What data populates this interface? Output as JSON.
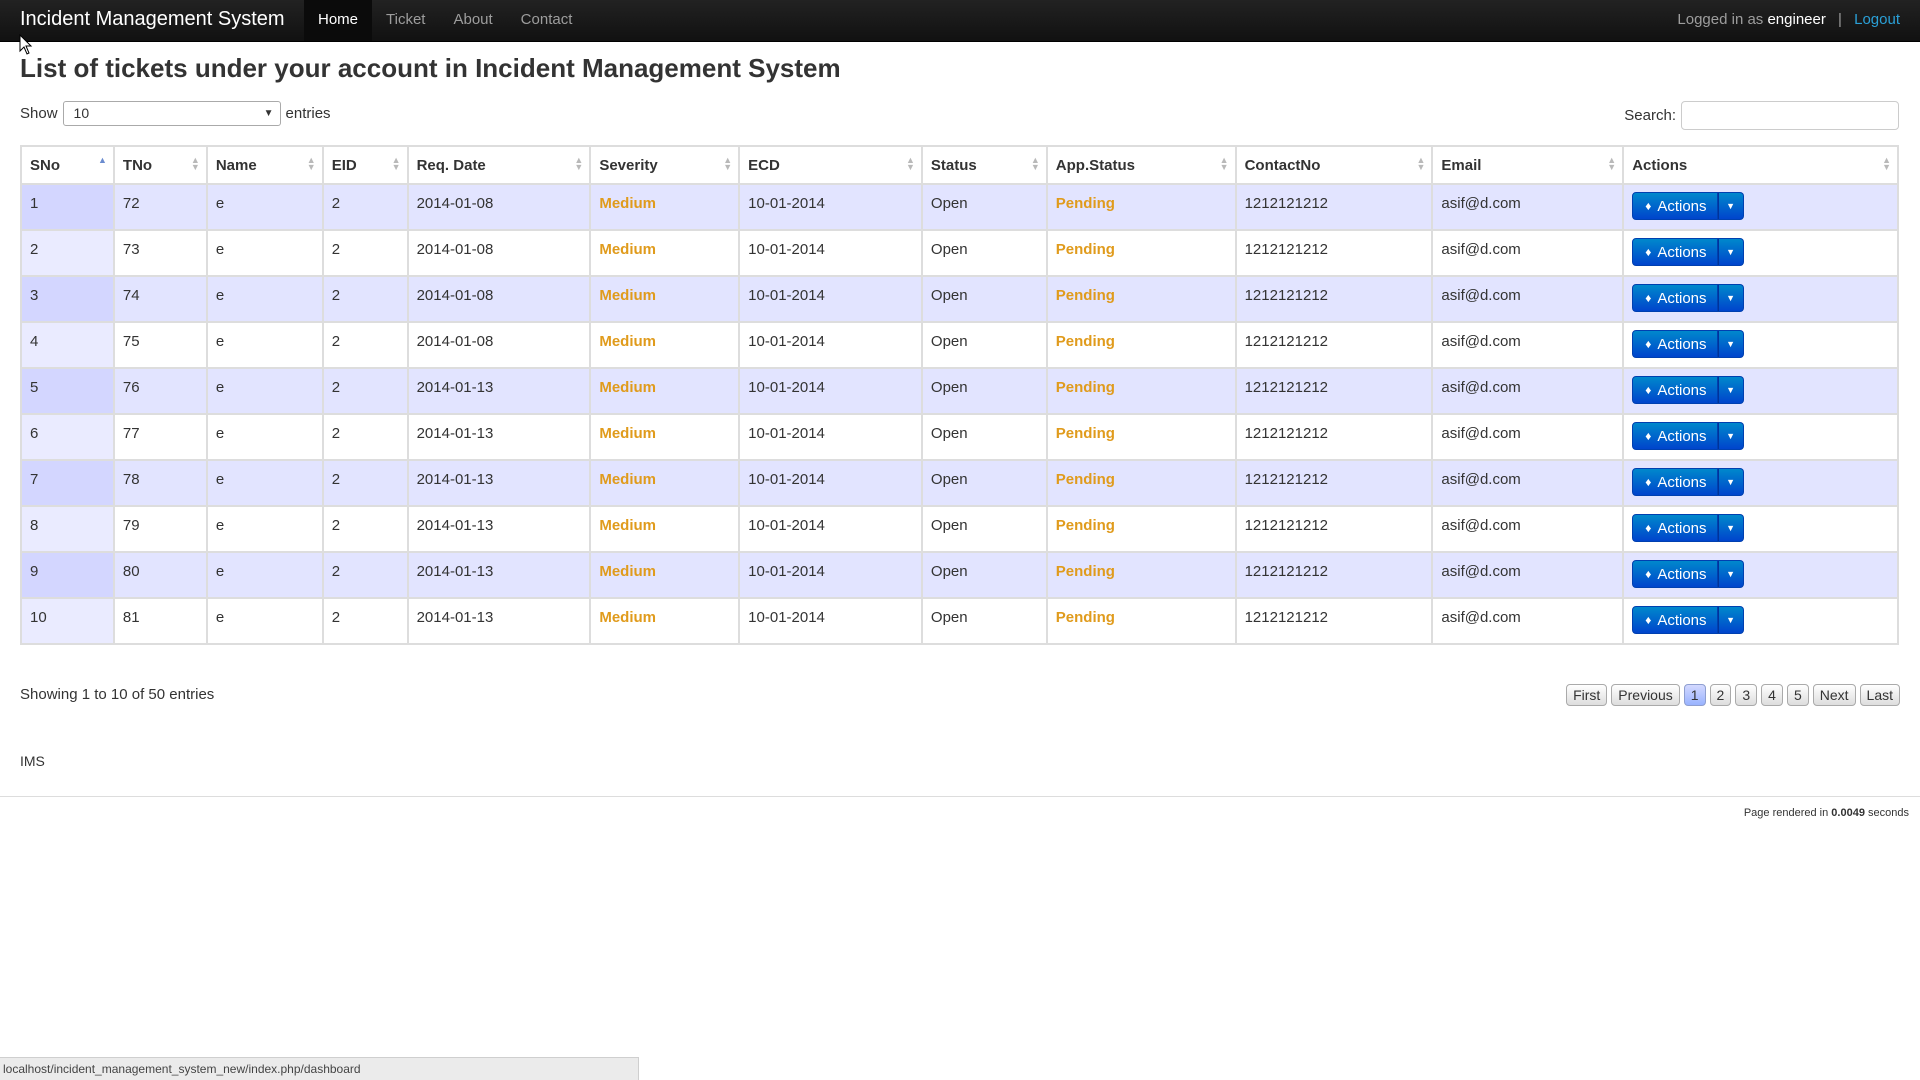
{
  "navbar": {
    "brand": "Incident Management System",
    "items": [
      {
        "label": "Home",
        "active": true
      },
      {
        "label": "Ticket",
        "active": false
      },
      {
        "label": "About",
        "active": false
      },
      {
        "label": "Contact",
        "active": false
      }
    ],
    "logged_in_prefix": "Logged in as",
    "username": "engineer",
    "separator": "|",
    "logout_label": "Logout"
  },
  "page_title": "List of tickets under your account in Incident Management System",
  "length": {
    "show_label": "Show",
    "selected": "10",
    "entries_label": "entries"
  },
  "search": {
    "label": "Search:",
    "value": ""
  },
  "table": {
    "columns": [
      "SNo",
      "TNo",
      "Name",
      "EID",
      "Req. Date",
      "Severity",
      "ECD",
      "Status",
      "App.Status",
      "ContactNo",
      "Email",
      "Actions"
    ],
    "action_label": "Actions",
    "rows": [
      {
        "sno": "1",
        "tno": "72",
        "name": "e",
        "eid": "2",
        "req_date": "2014-01-08",
        "severity": "Medium",
        "ecd": "10-01-2014",
        "status": "Open",
        "app_status": "Pending",
        "contact": "1212121212",
        "email": "asif@d.com"
      },
      {
        "sno": "2",
        "tno": "73",
        "name": "e",
        "eid": "2",
        "req_date": "2014-01-08",
        "severity": "Medium",
        "ecd": "10-01-2014",
        "status": "Open",
        "app_status": "Pending",
        "contact": "1212121212",
        "email": "asif@d.com"
      },
      {
        "sno": "3",
        "tno": "74",
        "name": "e",
        "eid": "2",
        "req_date": "2014-01-08",
        "severity": "Medium",
        "ecd": "10-01-2014",
        "status": "Open",
        "app_status": "Pending",
        "contact": "1212121212",
        "email": "asif@d.com"
      },
      {
        "sno": "4",
        "tno": "75",
        "name": "e",
        "eid": "2",
        "req_date": "2014-01-08",
        "severity": "Medium",
        "ecd": "10-01-2014",
        "status": "Open",
        "app_status": "Pending",
        "contact": "1212121212",
        "email": "asif@d.com"
      },
      {
        "sno": "5",
        "tno": "76",
        "name": "e",
        "eid": "2",
        "req_date": "2014-01-13",
        "severity": "Medium",
        "ecd": "10-01-2014",
        "status": "Open",
        "app_status": "Pending",
        "contact": "1212121212",
        "email": "asif@d.com"
      },
      {
        "sno": "6",
        "tno": "77",
        "name": "e",
        "eid": "2",
        "req_date": "2014-01-13",
        "severity": "Medium",
        "ecd": "10-01-2014",
        "status": "Open",
        "app_status": "Pending",
        "contact": "1212121212",
        "email": "asif@d.com"
      },
      {
        "sno": "7",
        "tno": "78",
        "name": "e",
        "eid": "2",
        "req_date": "2014-01-13",
        "severity": "Medium",
        "ecd": "10-01-2014",
        "status": "Open",
        "app_status": "Pending",
        "contact": "1212121212",
        "email": "asif@d.com"
      },
      {
        "sno": "8",
        "tno": "79",
        "name": "e",
        "eid": "2",
        "req_date": "2014-01-13",
        "severity": "Medium",
        "ecd": "10-01-2014",
        "status": "Open",
        "app_status": "Pending",
        "contact": "1212121212",
        "email": "asif@d.com"
      },
      {
        "sno": "9",
        "tno": "80",
        "name": "e",
        "eid": "2",
        "req_date": "2014-01-13",
        "severity": "Medium",
        "ecd": "10-01-2014",
        "status": "Open",
        "app_status": "Pending",
        "contact": "1212121212",
        "email": "asif@d.com"
      },
      {
        "sno": "10",
        "tno": "81",
        "name": "e",
        "eid": "2",
        "req_date": "2014-01-13",
        "severity": "Medium",
        "ecd": "10-01-2014",
        "status": "Open",
        "app_status": "Pending",
        "contact": "1212121212",
        "email": "asif@d.com"
      }
    ]
  },
  "info": "Showing 1 to 10 of 50 entries",
  "pagination": {
    "first": "First",
    "previous": "Previous",
    "next": "Next",
    "last": "Last",
    "pages": [
      "1",
      "2",
      "3",
      "4",
      "5"
    ],
    "active_page": "1"
  },
  "footer": {
    "brand": "IMS",
    "rendered_prefix": "Page rendered in",
    "rendered_time": "0.0049",
    "rendered_suffix": "seconds"
  },
  "status_bar": {
    "url": "localhost/incident_management_system_new/index.php/dashboard"
  },
  "colors": {
    "severity": "#e09b1c",
    "button": "#0044cc",
    "odd_row": "#e2e4ff",
    "navbar": "#1b1b1b",
    "logout_link": "#2a9fd6"
  },
  "icons": {
    "action_button": "tag-icon",
    "dropdown": "caret-down-icon",
    "sort": "sort-arrows-icon"
  }
}
